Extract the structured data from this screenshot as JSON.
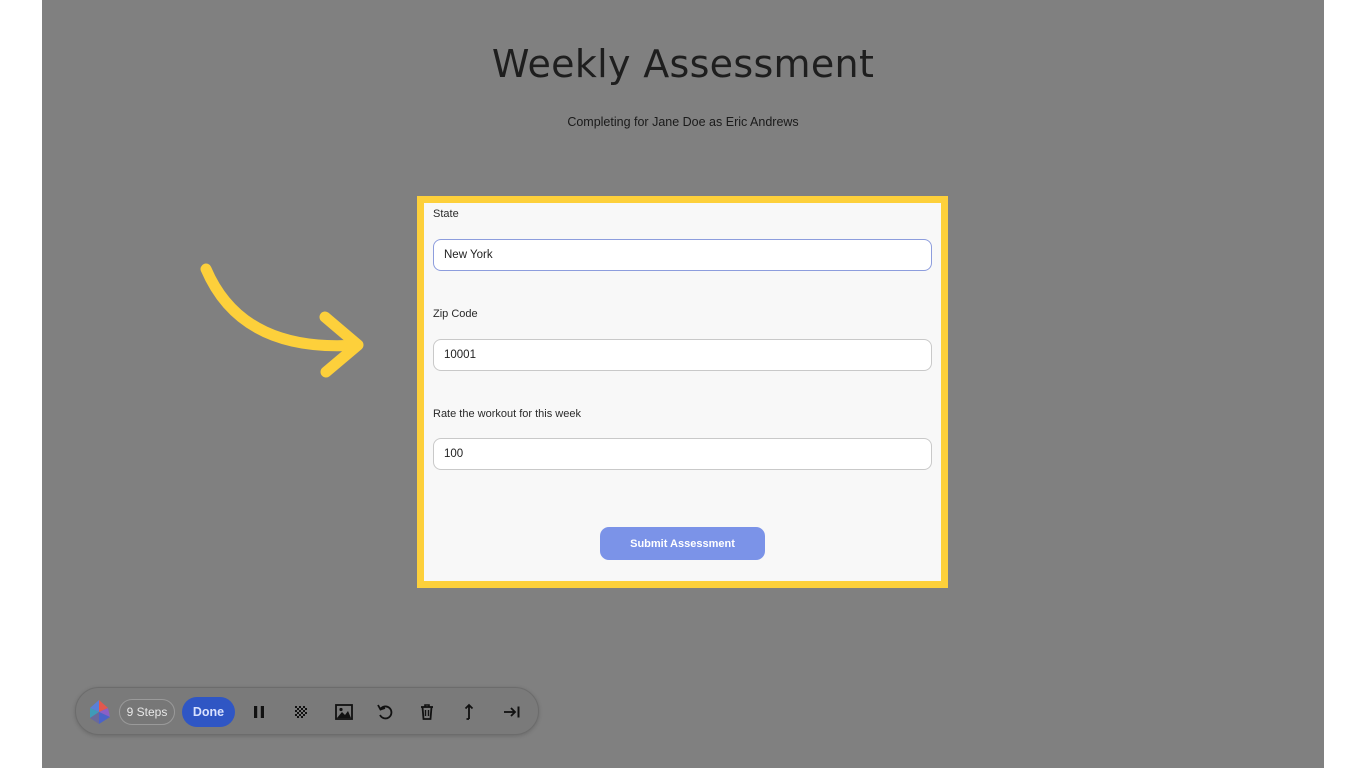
{
  "page": {
    "title": "Weekly Assessment",
    "subtitle": "Completing for Jane Doe as Eric Andrews"
  },
  "form": {
    "fields": [
      {
        "label": "State",
        "value": "New York"
      },
      {
        "label": "Zip Code",
        "value": "10001"
      },
      {
        "label": "Rate the workout for this week",
        "value": "100"
      }
    ],
    "submit_label": "Submit Assessment"
  },
  "colors": {
    "highlight": "#fdd03b",
    "overlay": "#808080",
    "submit_button": "#7b93e8",
    "done_button": "#2f56c4"
  },
  "toolbar": {
    "steps_label": "9 Steps",
    "done_label": "Done",
    "icons": [
      "pause-icon",
      "blur-icon",
      "image-icon",
      "undo-icon",
      "trash-icon",
      "export-icon",
      "skip-to-end-icon"
    ]
  }
}
